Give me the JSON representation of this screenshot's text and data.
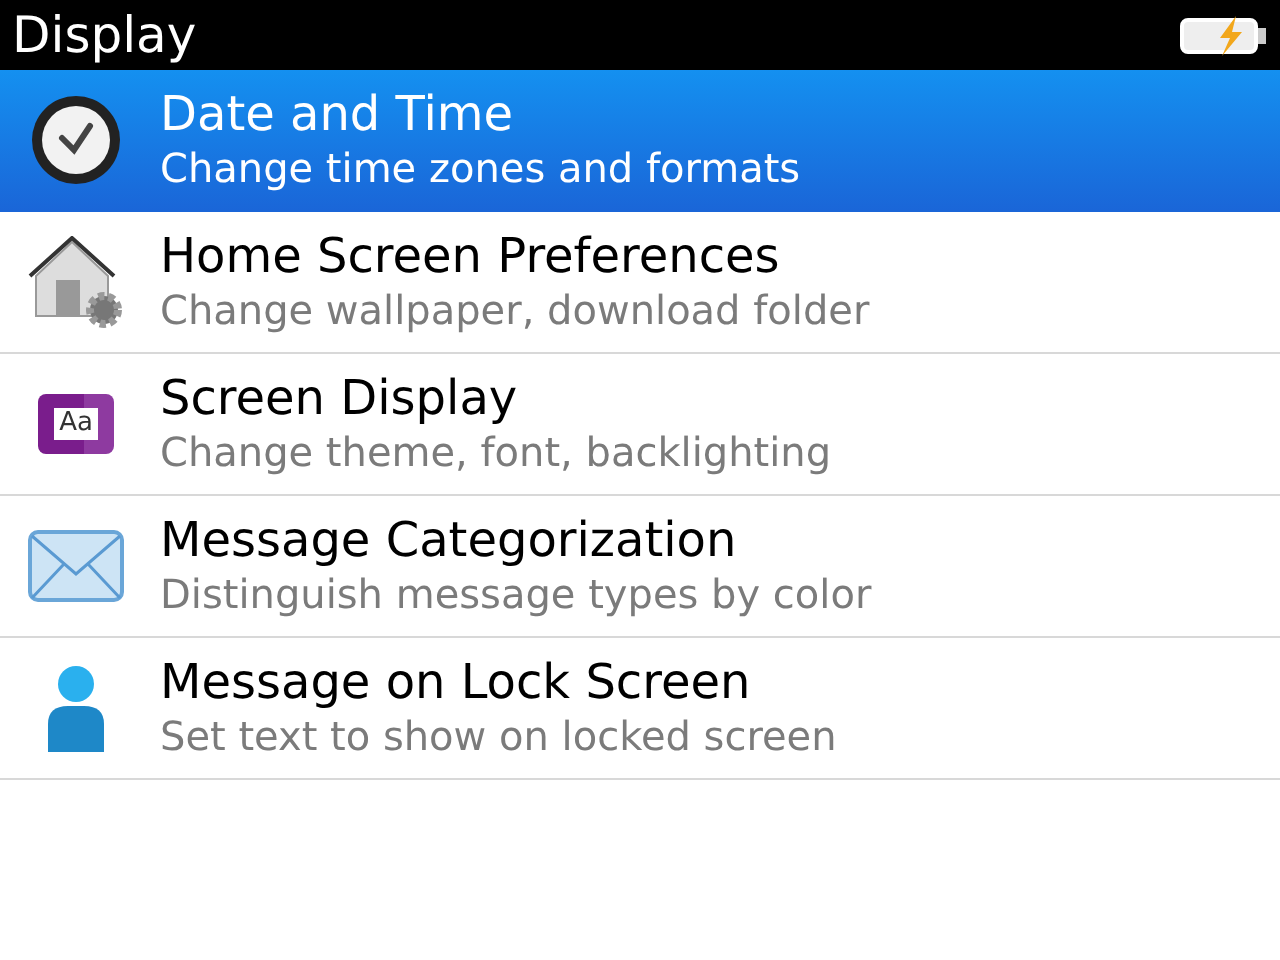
{
  "window": {
    "title": "Display"
  },
  "items": [
    {
      "kind": "clock",
      "title": "Date and Time",
      "subtitle": "Change time zones and formats",
      "selected": true
    },
    {
      "kind": "home",
      "title": "Home Screen Preferences",
      "subtitle": "Change wallpaper, download folder",
      "selected": false
    },
    {
      "kind": "theme",
      "icon_text": "Aa",
      "title": "Screen Display",
      "subtitle": "Change theme, font, backlighting",
      "selected": false
    },
    {
      "kind": "mail",
      "title": "Message Categorization",
      "subtitle": "Distinguish message types by color",
      "selected": false
    },
    {
      "kind": "person",
      "title": "Message on Lock Screen",
      "subtitle": "Set text to show on locked screen",
      "selected": false
    }
  ]
}
